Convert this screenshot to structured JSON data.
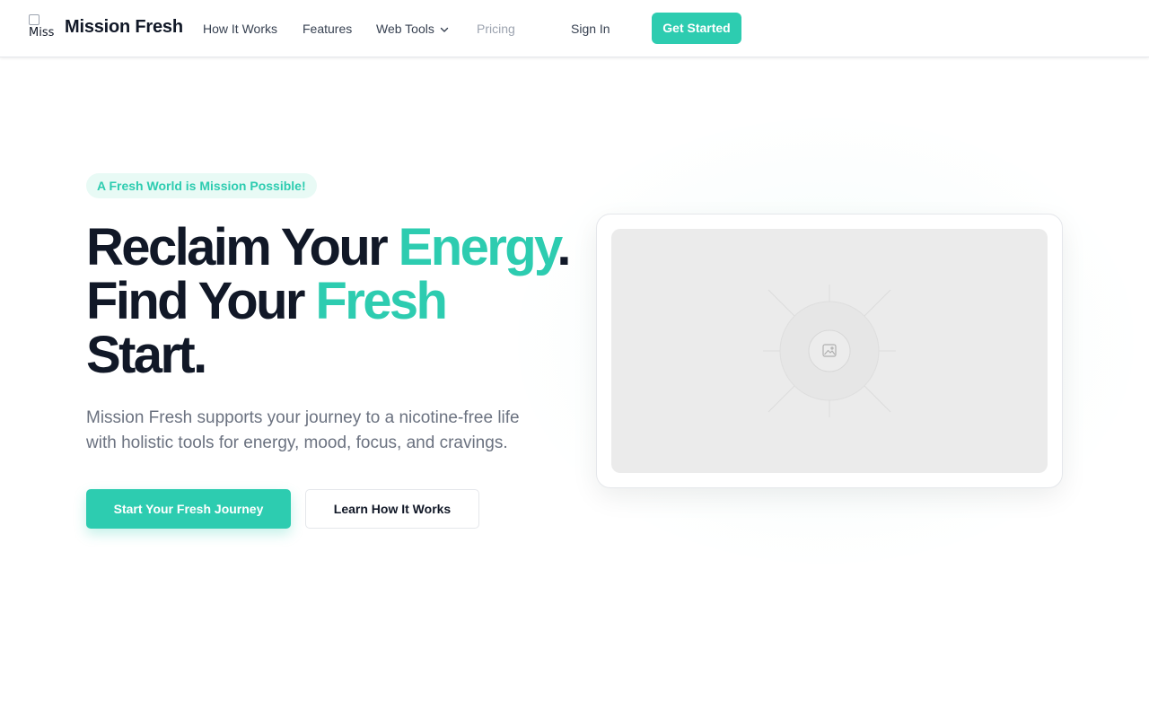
{
  "header": {
    "logo_alt": "Miss",
    "brand": "Mission Fresh",
    "nav": [
      {
        "label": "How It Works"
      },
      {
        "label": "Features"
      },
      {
        "label": "Web Tools"
      },
      {
        "label": "Pricing"
      }
    ],
    "sign_in": "Sign In",
    "get_started": "Get Started"
  },
  "hero": {
    "badge": "A Fresh World is Mission Possible!",
    "headline": {
      "line1_a": "Reclaim Your ",
      "line1_accent": "Energy",
      "line1_b": ".",
      "line2_a": "Find Your ",
      "line2_accent": "Fresh",
      "line3": "Start."
    },
    "subtitle": "Mission Fresh supports your journey to a nicotine-free life with holistic tools for energy, mood, focus, and cravings.",
    "primary_cta": "Start Your Fresh Journey",
    "secondary_cta": "Learn How It Works"
  },
  "colors": {
    "accent": "#2dccb0",
    "text_dark": "#111827",
    "text_muted": "#6b7280",
    "badge_bg": "#e8faf5"
  },
  "icons": {
    "dropdown": "chevron-down-icon",
    "image_placeholder": "image-icon"
  }
}
